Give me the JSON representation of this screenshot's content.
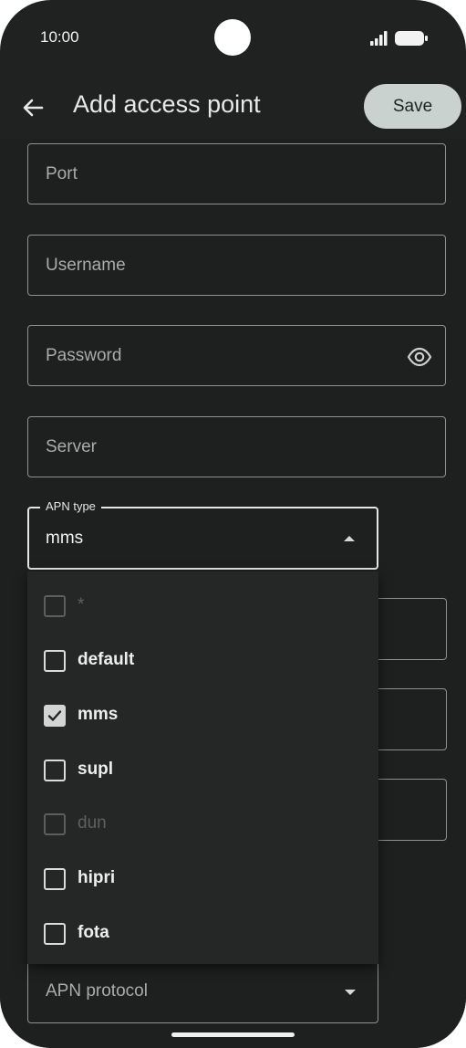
{
  "status_bar": {
    "time": "10:00"
  },
  "app_bar": {
    "title": "Add access point",
    "save_label": "Save"
  },
  "fields": {
    "port_placeholder": "Port",
    "username_placeholder": "Username",
    "password_placeholder": "Password",
    "server_placeholder": "Server"
  },
  "apn_type": {
    "label": "APN type",
    "value": "mms",
    "options": [
      {
        "label": "*",
        "checked": false,
        "enabled": false
      },
      {
        "label": "default",
        "checked": false,
        "enabled": true
      },
      {
        "label": "mms",
        "checked": true,
        "enabled": true
      },
      {
        "label": "supl",
        "checked": false,
        "enabled": true
      },
      {
        "label": "dun",
        "checked": false,
        "enabled": false
      },
      {
        "label": "hipri",
        "checked": false,
        "enabled": true
      },
      {
        "label": "fota",
        "checked": false,
        "enabled": true
      }
    ]
  },
  "apn_protocol": {
    "placeholder": "APN protocol"
  },
  "colors": {
    "background": "#1e1f1f",
    "save_button": "#c9d2cf",
    "menu_background": "#252626"
  }
}
